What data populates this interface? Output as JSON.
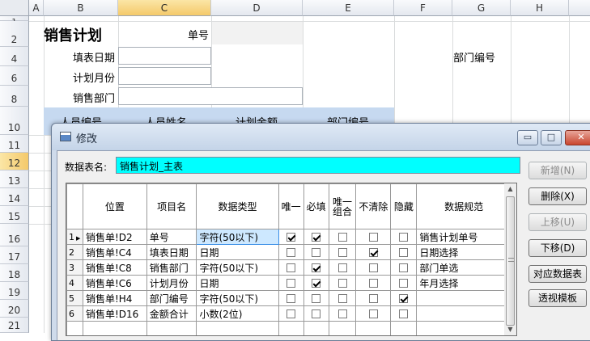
{
  "spreadsheet": {
    "columns": [
      "A",
      "B",
      "C",
      "D",
      "E",
      "F",
      "G",
      "H"
    ],
    "rows": [
      "1",
      "2",
      "4",
      "6",
      "8",
      "10",
      "11",
      "12",
      "13",
      "14",
      "15",
      "16",
      "17",
      "18",
      "19",
      "20",
      "21"
    ],
    "selected_column": "C",
    "selected_row": "12",
    "title": "销售计划",
    "order_no_label": "单号",
    "fill_date_label": "填表日期",
    "plan_month_label": "计划月份",
    "sales_dept_label": "销售部门",
    "dept_no_label": "部门编号",
    "table_headers": [
      "人员编号",
      "人员姓名",
      "计划金额",
      "部门编号"
    ]
  },
  "dialog": {
    "title": "修改",
    "window_buttons": {
      "minimize": "▭",
      "maximize": "□",
      "close": "✕"
    },
    "table_name_label": "数据表名:",
    "table_name_value": "销售计划_主表",
    "buttons": {
      "add": "新增(N)",
      "delete": "删除(X)",
      "move_up": "上移(U)",
      "move_down": "下移(D)",
      "map_table": "对应数据表",
      "pivot_template": "透视模板"
    },
    "grid": {
      "headers": [
        "位置",
        "项目名",
        "数据类型",
        "唯一",
        "必填",
        "唯一组合",
        "不清除",
        "隐藏",
        "数据规范"
      ],
      "rows": [
        {
          "num": "1",
          "pos": "销售单!D2",
          "name": "单号",
          "type": "字符(50以下)",
          "unique": true,
          "required": true,
          "combo": false,
          "noclear": false,
          "hidden": false,
          "rule": "销售计划单号",
          "selected": true
        },
        {
          "num": "2",
          "pos": "销售单!C4",
          "name": "填表日期",
          "type": "日期",
          "unique": false,
          "required": false,
          "combo": false,
          "noclear": true,
          "hidden": false,
          "rule": "日期选择",
          "selected": false
        },
        {
          "num": "3",
          "pos": "销售单!C8",
          "name": "销售部门",
          "type": "字符(50以下)",
          "unique": false,
          "required": true,
          "combo": false,
          "noclear": false,
          "hidden": false,
          "rule": "部门单选",
          "selected": false
        },
        {
          "num": "4",
          "pos": "销售单!C6",
          "name": "计划月份",
          "type": "日期",
          "unique": false,
          "required": true,
          "combo": false,
          "noclear": false,
          "hidden": false,
          "rule": "年月选择",
          "selected": false
        },
        {
          "num": "5",
          "pos": "销售单!H4",
          "name": "部门编号",
          "type": "字符(50以下)",
          "unique": false,
          "required": false,
          "combo": false,
          "noclear": false,
          "hidden": true,
          "rule": "",
          "selected": false
        },
        {
          "num": "6",
          "pos": "销售单!D16",
          "name": "金额合计",
          "type": "小数(2位)",
          "unique": false,
          "required": false,
          "combo": false,
          "noclear": false,
          "hidden": false,
          "rule": "",
          "selected": false
        }
      ]
    }
  }
}
